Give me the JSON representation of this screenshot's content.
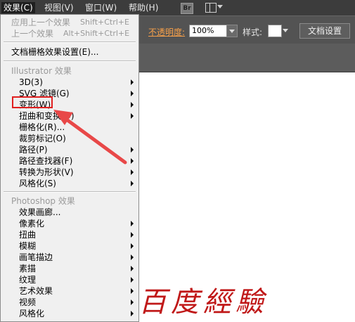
{
  "menubar": {
    "items": [
      {
        "label": "效果(C)"
      },
      {
        "label": "视图(V)"
      },
      {
        "label": "窗口(W)"
      },
      {
        "label": "帮助(H)"
      }
    ],
    "bridge_label": "Br"
  },
  "controlbar": {
    "opacity_label": "不透明度:",
    "opacity_value": "100%",
    "style_label": "样式:",
    "doc_settings": "文档设置"
  },
  "menu": {
    "apply_last": {
      "label": "应用上一个效果",
      "shortcut": "Shift+Ctrl+E"
    },
    "last_effect": {
      "label": "上一个效果",
      "shortcut": "Alt+Shift+Ctrl+E"
    },
    "raster_settings": "文档栅格效果设置(E)...",
    "illustrator_header": "Illustrator 效果",
    "illustrator_items": [
      {
        "label": "3D(3)"
      },
      {
        "label": "SVG 滤镜(G)"
      },
      {
        "label": "变形(W)"
      },
      {
        "label": "扭曲和变换(D)"
      },
      {
        "label": "栅格化(R)..."
      },
      {
        "label": "裁剪标记(O)"
      },
      {
        "label": "路径(P)"
      },
      {
        "label": "路径查找器(F)"
      },
      {
        "label": "转换为形状(V)"
      },
      {
        "label": "风格化(S)"
      }
    ],
    "photoshop_header": "Photoshop 效果",
    "photoshop_items": [
      {
        "label": "效果画廊..."
      },
      {
        "label": "像素化"
      },
      {
        "label": "扭曲"
      },
      {
        "label": "模糊"
      },
      {
        "label": "画笔描边"
      },
      {
        "label": "素描"
      },
      {
        "label": "纹理"
      },
      {
        "label": "艺术效果"
      },
      {
        "label": "视频"
      },
      {
        "label": "风格化"
      }
    ]
  },
  "watermark": "百度經驗",
  "colors": {
    "accent_highlight": "#e02020",
    "opacity_label": "#f7a04a"
  }
}
